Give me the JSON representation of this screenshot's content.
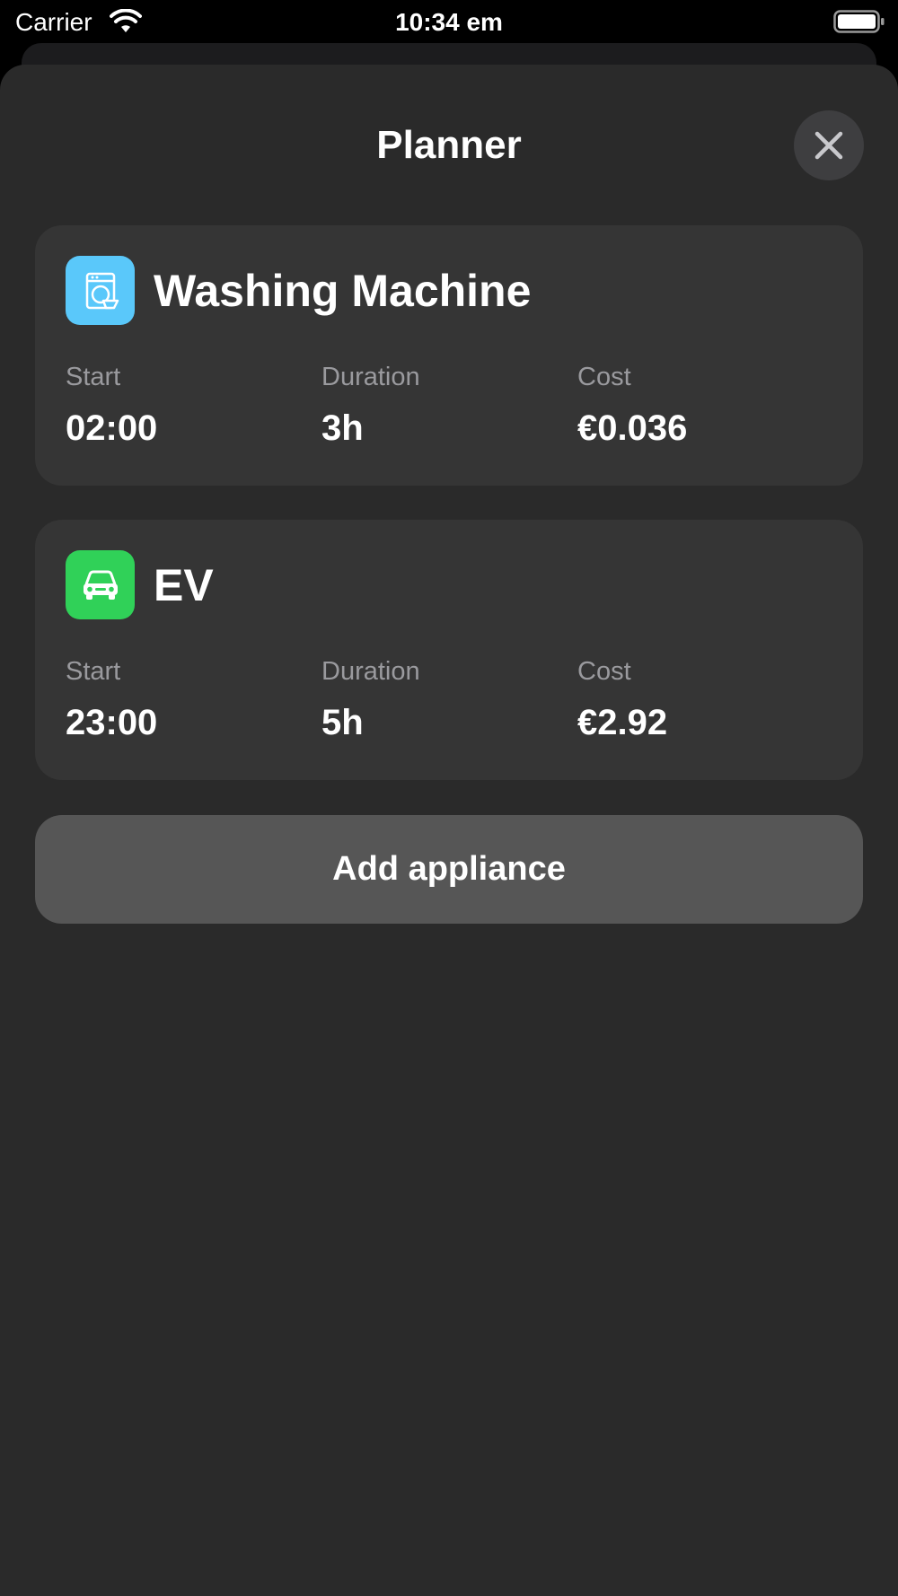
{
  "status_bar": {
    "carrier": "Carrier",
    "time": "10:34 em",
    "wifi_icon": "wifi-icon",
    "battery_icon": "battery-icon"
  },
  "sheet": {
    "title": "Planner",
    "close_icon": "close-icon"
  },
  "appliances": [
    {
      "name": "Washing Machine",
      "icon": "washing-machine-icon",
      "icon_color": "#5ac8fa",
      "start_label": "Start",
      "start": "02:00",
      "duration_label": "Duration",
      "duration": "3h",
      "cost_label": "Cost",
      "cost": "€0.036"
    },
    {
      "name": "EV",
      "icon": "car-icon",
      "icon_color": "#30d158",
      "start_label": "Start",
      "start": "23:00",
      "duration_label": "Duration",
      "duration": "5h",
      "cost_label": "Cost",
      "cost": "€2.92"
    }
  ],
  "add_button": {
    "label": "Add appliance"
  },
  "colors": {
    "sheet_background": "#2a2a2a",
    "card_background": "#353535",
    "button_background": "#565656",
    "secondary_text": "#9a9a9e"
  }
}
